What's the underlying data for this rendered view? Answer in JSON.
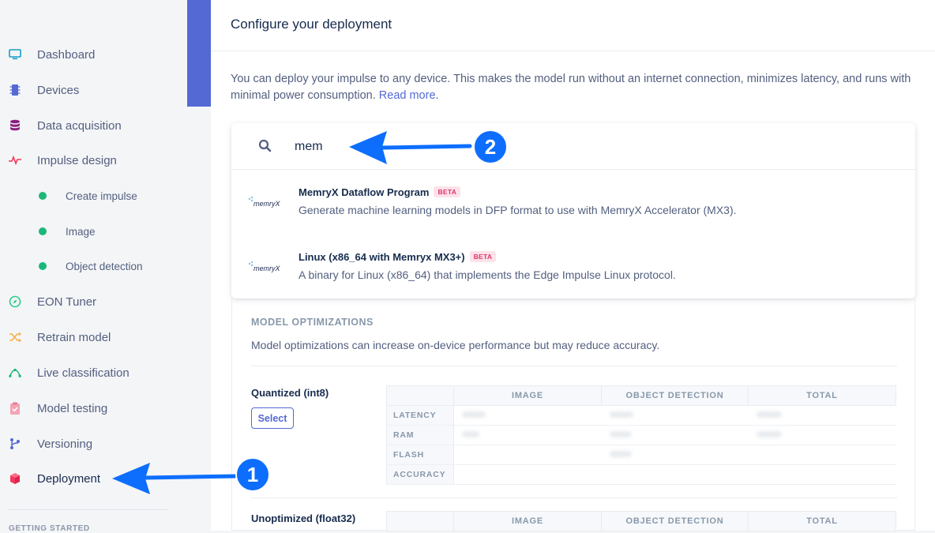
{
  "sidebar": {
    "items": [
      {
        "label": "Dashboard",
        "icon": "monitor-icon",
        "color": "#11a0c9"
      },
      {
        "label": "Devices",
        "icon": "chip-icon",
        "color": "#5469d4"
      },
      {
        "label": "Data acquisition",
        "icon": "database-icon",
        "color": "#8b1e7f"
      },
      {
        "label": "Impulse design",
        "icon": "pulse-icon",
        "color": "#f5365c"
      },
      {
        "label": "EON Tuner",
        "icon": "compass-icon",
        "color": "#2dce89"
      },
      {
        "label": "Retrain model",
        "icon": "shuffle-icon",
        "color": "#fbb140"
      },
      {
        "label": "Live classification",
        "icon": "graph-icon",
        "color": "#1ab779"
      },
      {
        "label": "Model testing",
        "icon": "clipboard-check-icon",
        "color": "#f3a4b5"
      },
      {
        "label": "Versioning",
        "icon": "branch-icon",
        "color": "#5469d4"
      },
      {
        "label": "Deployment",
        "icon": "cube-icon",
        "color": "#f5365c"
      }
    ],
    "sub_items": [
      {
        "label": "Create impulse"
      },
      {
        "label": "Image"
      },
      {
        "label": "Object detection"
      }
    ],
    "section_label": "GETTING STARTED"
  },
  "main": {
    "title": "Configure your deployment",
    "intro_text": "You can deploy your impulse to any device. This makes the model run without an internet connection, minimizes latency, and runs with minimal power consumption.",
    "intro_link": "Read more",
    "search": {
      "value": "mem"
    },
    "results": [
      {
        "name": "MemryX Dataflow Program",
        "badge": "BETA",
        "description": "Generate machine learning models in DFP format to use with MemryX Accelerator (MX3).",
        "logo_text": "memryX"
      },
      {
        "name": "Linux (x86_64 with Memryx MX3+)",
        "badge": "BETA",
        "description": "A binary for Linux (x86_64) that implements the Edge Impulse Linux protocol.",
        "logo_text": "memryX"
      }
    ],
    "optimizations": {
      "heading": "MODEL OPTIMIZATIONS",
      "description": "Model optimizations can increase on-device performance but may reduce accuracy.",
      "options": [
        {
          "name": "Quantized (int8)",
          "select_label": "Select"
        },
        {
          "name": "Unoptimized (float32)"
        }
      ],
      "columns": [
        "IMAGE",
        "OBJECT DETECTION",
        "TOTAL"
      ],
      "rows": [
        "LATENCY",
        "RAM",
        "FLASH",
        "ACCURACY"
      ]
    }
  },
  "annotations": {
    "marker_1": "1",
    "marker_2": "2",
    "color": "#0d6efd"
  }
}
